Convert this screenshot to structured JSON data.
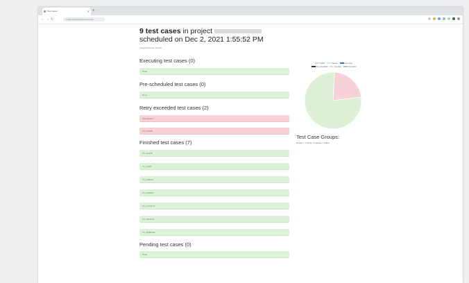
{
  "browser": {
    "tab_title": "Test Cases",
    "url": "localhost/testcases/scheduled"
  },
  "header": {
    "count": "9 test cases",
    "in_project": " in project",
    "scheduled": "scheduled on Dec 2, 2021 1:55:52 PM",
    "subline": "Usage/Schedule Details"
  },
  "sections": {
    "executing": {
      "title": "Executing test cases (0)",
      "items": [
        "None"
      ]
    },
    "prescheduled": {
      "title": "Pre-scheduled test cases (0)",
      "items": [
        "None"
      ]
    },
    "retry": {
      "title": "Retry exceeded test cases (2)",
      "items": [
        "Scheduled-1",
        "TC_LOGIN"
      ]
    },
    "finished": {
      "title": "Finished test cases (7)",
      "items": [
        "TC_Search",
        "TC_CART",
        "TC_CHECK",
        "TC_ORDER",
        "TC_LOGOUT",
        "TC_SIGNUP",
        "TC_PROFILE"
      ]
    },
    "pending": {
      "title": "Pending test cases (0)",
      "items": [
        "None"
      ]
    }
  },
  "legend": [
    {
      "label": "Failed",
      "color": "#f6c7cd"
    },
    {
      "label": "Passed",
      "color": "#d9efd3"
    },
    {
      "label": "Executing",
      "color": "#2f6fc7"
    },
    {
      "label": "Pre-scheduled",
      "color": "#333333"
    },
    {
      "label": "Pending",
      "color": "#cfe3f7"
    },
    {
      "label": "Cancelled",
      "color": "#bbbbbb"
    }
  ],
  "chart_data": {
    "type": "pie",
    "categories": [
      "Failed",
      "Passed"
    ],
    "values": [
      2,
      7
    ],
    "colors": [
      "#f6d2d8",
      "#dcf0d6"
    ]
  },
  "groups": {
    "title": "Test Case Groups:",
    "text": "Group 1 : 9 tests, 7 passed, 2 failed"
  }
}
